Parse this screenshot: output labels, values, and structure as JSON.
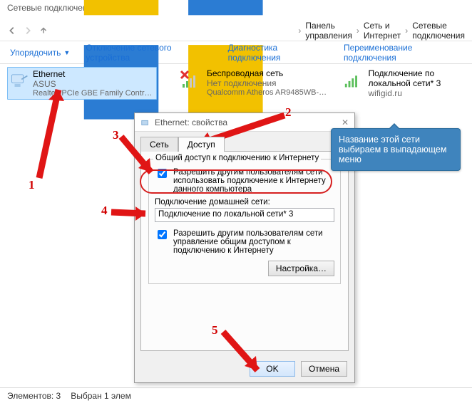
{
  "window_title": "Сетевые подключения",
  "breadcrumbs": {
    "root": "Панель управления",
    "mid": "Сеть и Интернет",
    "leaf": "Сетевые подключения"
  },
  "toolbar": {
    "organize": "Упорядочить",
    "disable": "Отключение сетевого устройства",
    "diagnose": "Диагностика подключения",
    "rename": "Переименование подключения"
  },
  "connections": [
    {
      "name": "Ethernet",
      "status": "ASUS",
      "adapter": "Realtek PCIe GBE Family Controller",
      "selected": true,
      "icon": "ethernet"
    },
    {
      "name": "Беспроводная сеть",
      "status": "Нет подключения",
      "adapter": "Qualcomm Atheros AR9485WB-E...",
      "selected": false,
      "icon": "wifi-x"
    },
    {
      "name": "Подключение по локальной сети* 3",
      "status": "wifigid.ru",
      "adapter": "",
      "selected": false,
      "icon": "wifi"
    }
  ],
  "statusbar": {
    "count_label": "Элементов: 3",
    "selection_label": "Выбран 1 элем"
  },
  "dialog": {
    "title": "Ethernet: свойства",
    "tab_network": "Сеть",
    "tab_sharing": "Доступ",
    "group_ics": "Общий доступ к подключению к Интернету",
    "chk_allow_share": "Разрешить другим пользователям сети использовать подключение к Интернету данного компьютера",
    "home_conn_label": "Подключение домашней сети:",
    "home_conn_value": "Подключение по локальной сети* 3",
    "chk_allow_control": "Разрешить другим пользователям сети управление общим доступом к подключению к Интернету",
    "btn_settings": "Настройка…",
    "btn_ok": "OK",
    "btn_cancel": "Отмена"
  },
  "callout_text": "Название этой сети выбираем в выпадающем меню",
  "annotations": {
    "n1": "1",
    "n2": "2",
    "n3": "3",
    "n4": "4",
    "n5": "5"
  }
}
